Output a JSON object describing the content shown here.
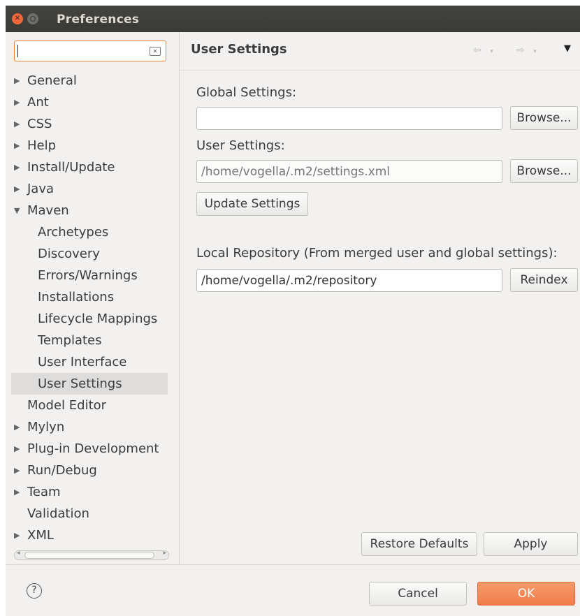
{
  "window": {
    "title": "Preferences"
  },
  "search": {
    "placeholder": ""
  },
  "tree": [
    {
      "label": "General",
      "expandable": true,
      "expanded": false,
      "level": 0
    },
    {
      "label": "Ant",
      "expandable": true,
      "expanded": false,
      "level": 0
    },
    {
      "label": "CSS",
      "expandable": true,
      "expanded": false,
      "level": 0
    },
    {
      "label": "Help",
      "expandable": true,
      "expanded": false,
      "level": 0
    },
    {
      "label": "Install/Update",
      "expandable": true,
      "expanded": false,
      "level": 0
    },
    {
      "label": "Java",
      "expandable": true,
      "expanded": false,
      "level": 0
    },
    {
      "label": "Maven",
      "expandable": true,
      "expanded": true,
      "level": 0
    },
    {
      "label": "Archetypes",
      "expandable": false,
      "level": 1
    },
    {
      "label": "Discovery",
      "expandable": false,
      "level": 1
    },
    {
      "label": "Errors/Warnings",
      "expandable": false,
      "level": 1
    },
    {
      "label": "Installations",
      "expandable": false,
      "level": 1
    },
    {
      "label": "Lifecycle Mappings",
      "expandable": false,
      "level": 1
    },
    {
      "label": "Templates",
      "expandable": false,
      "level": 1
    },
    {
      "label": "User Interface",
      "expandable": false,
      "level": 1
    },
    {
      "label": "User Settings",
      "expandable": false,
      "level": 1,
      "selected": true
    },
    {
      "label": "Model Editor",
      "expandable": false,
      "level": 0
    },
    {
      "label": "Mylyn",
      "expandable": true,
      "expanded": false,
      "level": 0
    },
    {
      "label": "Plug-in Development",
      "expandable": true,
      "expanded": false,
      "level": 0
    },
    {
      "label": "Run/Debug",
      "expandable": true,
      "expanded": false,
      "level": 0
    },
    {
      "label": "Team",
      "expandable": true,
      "expanded": false,
      "level": 0
    },
    {
      "label": "Validation",
      "expandable": false,
      "level": 0
    },
    {
      "label": "XML",
      "expandable": true,
      "expanded": false,
      "level": 0
    }
  ],
  "page": {
    "title": "User Settings",
    "global_settings_label": "Global Settings:",
    "global_settings_value": "",
    "user_settings_label": "User Settings:",
    "user_settings_placeholder": "/home/vogella/.m2/settings.xml",
    "browse_label": "Browse...",
    "update_settings_label": "Update Settings",
    "local_repo_label": "Local Repository (From merged user and global settings):",
    "local_repo_value": "/home/vogella/.m2/repository",
    "reindex_label": "Reindex",
    "restore_defaults_label": "Restore Defaults",
    "apply_label": "Apply"
  },
  "footer": {
    "help_glyph": "?",
    "cancel_label": "Cancel",
    "ok_label": "OK"
  },
  "colors": {
    "accent": "#ef7d4b",
    "titlebar": "#3a3935",
    "panel": "#f2f1f0"
  }
}
